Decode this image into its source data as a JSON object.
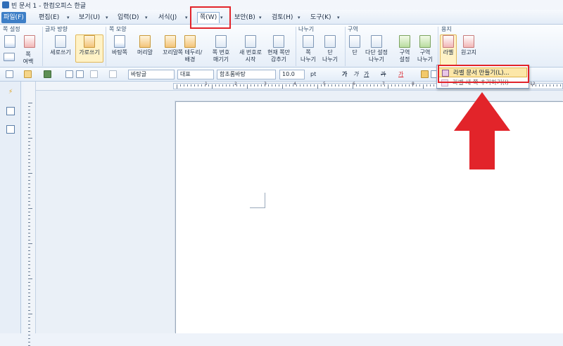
{
  "window": {
    "title": "빈 문서 1 - 한컴오피스 한글"
  },
  "menubar": {
    "items": [
      {
        "label": "파일(F)"
      },
      {
        "label": "편집(E)"
      },
      {
        "label": "보기(U)"
      },
      {
        "label": "입력(D)"
      },
      {
        "label": "서식(J)"
      },
      {
        "label": "쪽(W)"
      },
      {
        "label": "보안(B)"
      },
      {
        "label": "검토(H)"
      },
      {
        "label": "도구(K)"
      }
    ]
  },
  "ribbon": {
    "groups": {
      "page_setup": "쪽 설정",
      "text_direction": "글자 방향",
      "page_style": "쪽 모양",
      "breaks": "나누기",
      "section": "구역",
      "paper": "용지"
    },
    "buttons": {
      "page_margin": "쪽\n여백",
      "vertical": "세로쓰기",
      "horizontal": "가로쓰기",
      "background": "바탕쪽",
      "header": "머리말",
      "footer": "꼬리말",
      "border": "쪽 테두리/\n배경",
      "hide_page_number": "쪽 번호\n매기기",
      "new_number": "새 번호로\n시작",
      "hide_current": "현재 쪽만\n감추기",
      "page_break": "쪽\n나누기",
      "column_break": "단\n나누기",
      "columns": "단",
      "multi_column": "다단 설정\n나누기",
      "section_setup": "구역\n설정",
      "section_break": "구역\n나누기",
      "label": "라벨",
      "manuscript": "원고지"
    }
  },
  "toolbar": {
    "style": "바탕글",
    "font_kind": "대표",
    "font": "함초롬바탕",
    "size": "10.0",
    "size_unit": "pt",
    "bold": "가",
    "italic": "가",
    "underline": "가",
    "strike": "가",
    "color": "가"
  },
  "dropdown": {
    "items": [
      {
        "label": "라벨 문서 만들기(L)..."
      },
      {
        "label": "라벨 새 쪽 추가하기(I)"
      }
    ]
  },
  "ruler": {
    "marks": [
      "1",
      "2",
      "3",
      "4",
      "5",
      "6",
      "7",
      "8",
      "9",
      "10",
      "11",
      "12",
      "13"
    ]
  },
  "colors": {
    "annotation": "#e2242a",
    "accent": "#3e7fc7"
  }
}
